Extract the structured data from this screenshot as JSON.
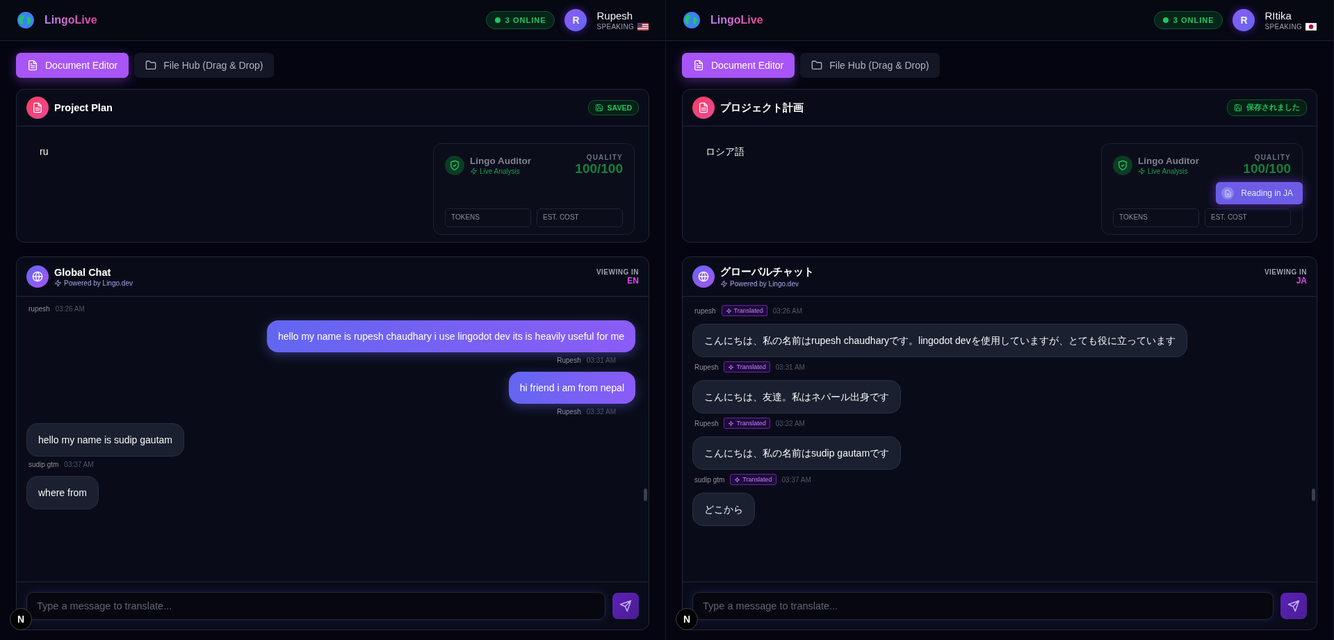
{
  "panes": [
    {
      "app_name": "LingoLive",
      "online": "3 ONLINE",
      "user": {
        "initial": "R",
        "name": "Rupesh",
        "speaking": "SPEAKING"
      },
      "tabs": [
        {
          "label": "Document Editor",
          "selected": true
        },
        {
          "label": "File Hub (Drag & Drop)",
          "selected": false
        }
      ],
      "document": {
        "title": "Project Plan",
        "status": "SAVED",
        "content": "ru",
        "auditor": {
          "title": "Lingo Auditor",
          "subtitle": "Live Analysis",
          "quality_label": "QUALITY",
          "quality": "100/100",
          "stats": [
            "TOKENS",
            "EST. COST"
          ]
        }
      },
      "chat": {
        "title": "Global Chat",
        "subtitle": "Powered by Lingo.dev",
        "viewing_label": "VIEWING IN",
        "language": "EN",
        "messages": [
          {
            "kind": "incoming",
            "sender": "rupesh",
            "time": "03:26 AM"
          },
          {
            "kind": "outgoing",
            "text": "hello my name is rupesh chaudhary i use lingodot dev its is heavily useful for me",
            "sender": "Rupesh",
            "time": "03:31 AM"
          },
          {
            "kind": "outgoing",
            "text": "hi friend i am from nepal",
            "sender": "Rupesh",
            "time": "03:32 AM"
          },
          {
            "kind": "incoming",
            "text": "hello my name is sudip gautam",
            "sender": "sudip gtm",
            "time": "03:37 AM"
          },
          {
            "kind": "incoming",
            "text": "where from"
          }
        ],
        "placeholder": "Type a message to translate..."
      },
      "dev_badge": "N"
    },
    {
      "app_name": "LingoLive",
      "online": "3 ONLINE",
      "user": {
        "initial": "R",
        "name": "RItika",
        "speaking": "SPEAKING"
      },
      "tabs": [
        {
          "label": "Document Editor",
          "selected": true
        },
        {
          "label": "File Hub (Drag & Drop)",
          "selected": false
        }
      ],
      "document": {
        "title": "プロジェクト計画",
        "status": "保存されました",
        "content": "ロシア語",
        "reading_badge": "Reading in JA",
        "auditor": {
          "title": "Lingo Auditor",
          "subtitle": "Live Analysis",
          "quality_label": "QUALITY",
          "quality": "100/100",
          "stats": [
            "TOKENS",
            "EST. COST"
          ]
        }
      },
      "chat": {
        "title": "グローバルチャット",
        "subtitle": "Powered by Lingo.dev",
        "viewing_label": "VIEWING IN",
        "language": "JA",
        "messages": [
          {
            "kind": "incoming",
            "sender": "rupesh",
            "badge": "Translated",
            "time": "03:26 AM"
          },
          {
            "kind": "incoming",
            "text": "こんにちは、私の名前はrupesh chaudharyです。lingodot devを使用していますが、とても役に立っています",
            "sender": "Rupesh",
            "badge": "Translated",
            "time": "03:31 AM"
          },
          {
            "kind": "incoming",
            "text": "こんにちは、友達。私はネパール出身です",
            "sender": "Rupesh",
            "badge": "Translated",
            "time": "03:32 AM"
          },
          {
            "kind": "incoming",
            "text": "こんにちは、私の名前はsudip gautamです",
            "sender": "sudip gtm",
            "badge": "Translated",
            "time": "03:37 AM"
          },
          {
            "kind": "incoming",
            "text": "どこから"
          }
        ],
        "placeholder": "Type a message to translate..."
      },
      "dev_badge": "N"
    }
  ]
}
